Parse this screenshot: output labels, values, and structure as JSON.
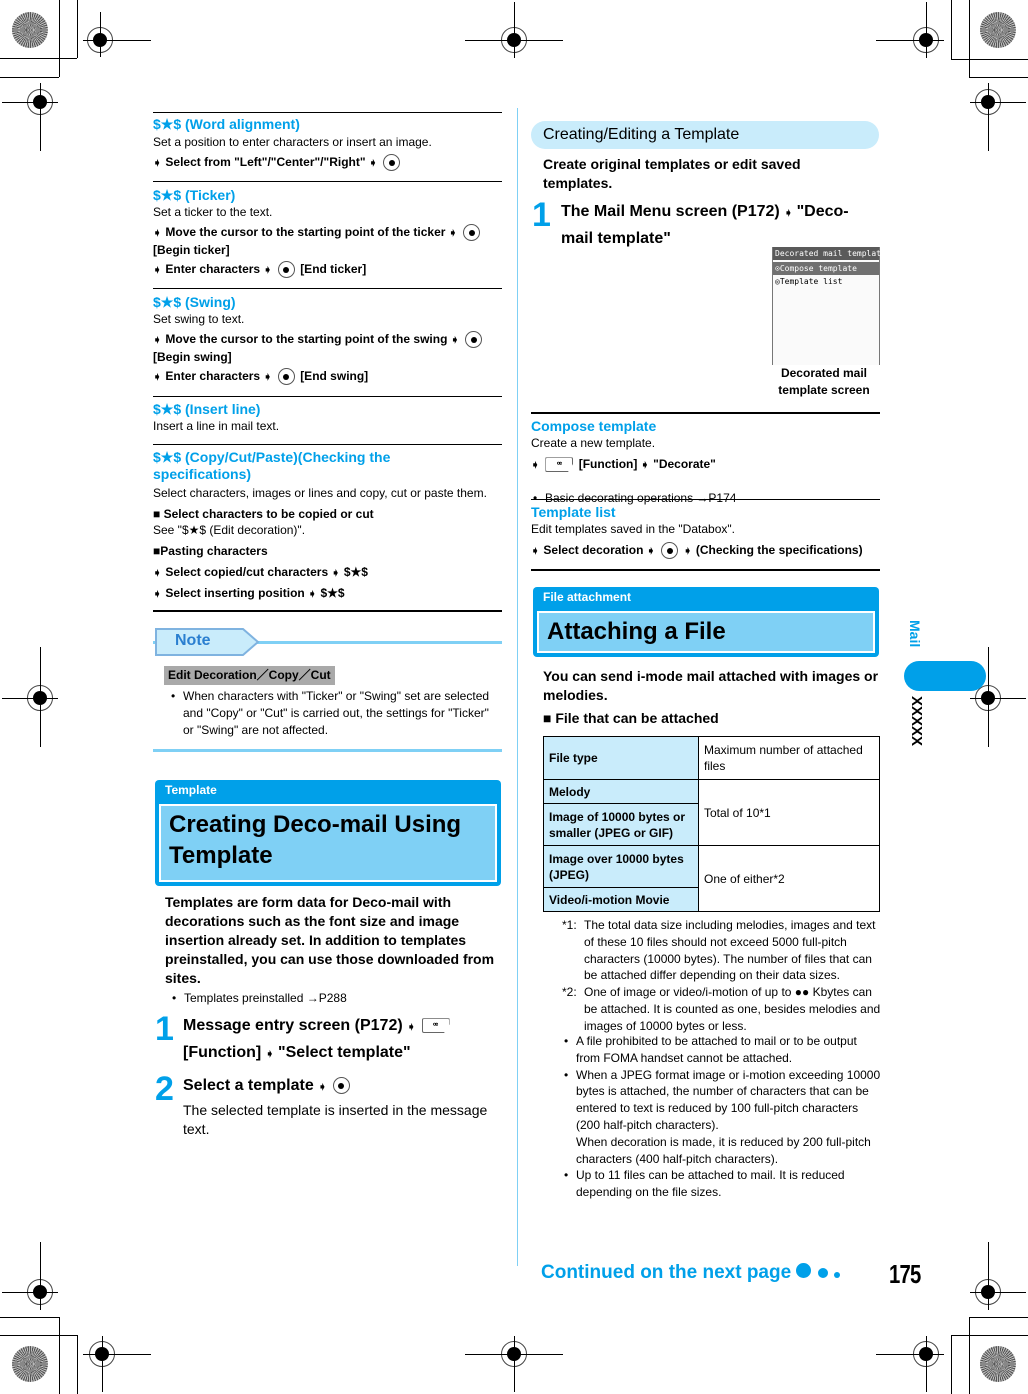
{
  "left": {
    "word_alignment": {
      "heading": "$★$ (Word alignment)",
      "desc": "Set a position to enter characters or insert an image.",
      "step1": "Select from \"Left\"/\"Center\"/\"Right\""
    },
    "ticker": {
      "heading": "$★$ (Ticker)",
      "desc": "Set a ticker to the text.",
      "step1": "Move the cursor to the starting point of the ticker",
      "step1_tail": "[Begin ticker]",
      "step2": "Enter characters",
      "step2_tail": "[End ticker]"
    },
    "swing": {
      "heading": "$★$ (Swing)",
      "desc": "Set swing to text.",
      "step1": "Move the cursor to the starting point of the swing",
      "step1_tail": "[Begin swing]",
      "step2": "Enter characters",
      "step2_tail": "[End swing]"
    },
    "insert_line": {
      "heading": "$★$ (Insert line)",
      "desc": "Insert a line in mail text."
    },
    "copy_cut_paste": {
      "heading_line1": "$★$ (Copy/Cut/Paste)(Checking the",
      "heading_line2": "specifications)",
      "desc": "Select characters, images or lines and copy, cut or paste them.",
      "sub1": "■ Select characters to be copied or cut",
      "sub1_desc": "See \"$★$ (Edit decoration)\".",
      "sub2": "■Pasting characters",
      "step1": "Select copied/cut characters",
      "step1_tail": "$★$",
      "step2": "Select inserting position",
      "step2_tail": "$★$"
    },
    "note": {
      "tab_label": "Note",
      "category": "Edit Decoration／Copy／Cut",
      "bullet": "When characters with \"Ticker\" or  \"Swing\" set are selected and \"Copy\" or \"Cut\" is carried out, the settings for \"Ticker\" or \"Swing\" are not affected."
    },
    "template_section": {
      "label": "Template",
      "title_line1": "Creating Deco-mail Using",
      "title_line2": "Template",
      "intro": "Templates are form data for Deco-mail with decorations such as the font size and image insertion already set. In addition to templates preinstalled, you can use those downloaded from sites.",
      "bullet": "Templates preinstalled →P288",
      "step1_num": "1",
      "step1_a": "Message entry screen (P172)",
      "step1_key": "ꟹ",
      "step1_b": "[Function]",
      "step1_c": "\"Select template\"",
      "step2_num": "2",
      "step2_a": "Select a template",
      "step2_desc": "The selected template is inserted in the message text."
    }
  },
  "right": {
    "creating_editing": {
      "pill": "Creating/Editing a Template",
      "intro": "Create original templates or edit saved templates.",
      "step1_num": "1",
      "step1_a": "The Mail Menu screen (P172)",
      "step1_b": "\"Deco-mail template\"",
      "screen": {
        "title": "Decorated mail template",
        "items": [
          "Compose template",
          "Template list"
        ],
        "caption_line1": "Decorated mail",
        "caption_line2": "template screen"
      }
    },
    "compose_template": {
      "heading": "Compose template",
      "desc": "Create a new template.",
      "step_b": "[Function]",
      "step_c": "\"Decorate\"",
      "bullet": "Basic decorating operations →P174"
    },
    "template_list": {
      "heading": "Template list",
      "desc": "Edit templates saved in the \"Databox\".",
      "step_a": "Select decoration",
      "step_c": "(Checking the specifications)"
    },
    "file_attachment": {
      "label": "File attachment",
      "title": "Attaching a File",
      "intro": "You can send i-mode mail attached with images or melodies.",
      "sub": "■ File that can be attached",
      "table": {
        "header": [
          "File type",
          "Maximum number of attached files"
        ],
        "rows": [
          {
            "type": "Melody",
            "max": "Total of 10*1"
          },
          {
            "type": "Image of 10000 bytes or smaller (JPEG or GIF)",
            "max": ""
          },
          {
            "type": "Image over 10000 bytes (JPEG)",
            "max": "One of either*2"
          },
          {
            "type": "Video/i-motion Movie",
            "max": ""
          }
        ]
      },
      "footnotes": [
        {
          "mark": "*1:",
          "text": "The total data size including melodies, images and text of these 10 files should not exceed 5000 full-pitch characters (10000 bytes). The number of files that can be attached differ depending on their data sizes."
        },
        {
          "mark": "*2:",
          "text": "One of image or video/i-motion of up to ●● Kbytes can be attached. It is counted as one, besides melodies and images of 10000 bytes or less."
        }
      ],
      "bullets": [
        "A file prohibited to be attached to mail or to be output from FOMA handset cannot be attached.",
        "When a JPEG format image or i-motion exceeding 10000 bytes is attached, the number of characters that can be entered to text is reduced by 100 full-pitch characters (200 half-pitch characters).",
        "When decoration is made, it is reduced by 200 full-pitch characters (400 half-pitch characters).",
        "Up to 11 files can be attached to mail. It is reduced depending on the file sizes."
      ]
    }
  },
  "side_tab": {
    "section": "Mail",
    "chapter": "XXXXX"
  },
  "footer": {
    "continued": "Continued on the next page",
    "page_number": "175"
  },
  "colors": {
    "accent": "#00a0e9",
    "light_accent": "#7fd0f5",
    "pale_accent": "#c9ecfb"
  }
}
